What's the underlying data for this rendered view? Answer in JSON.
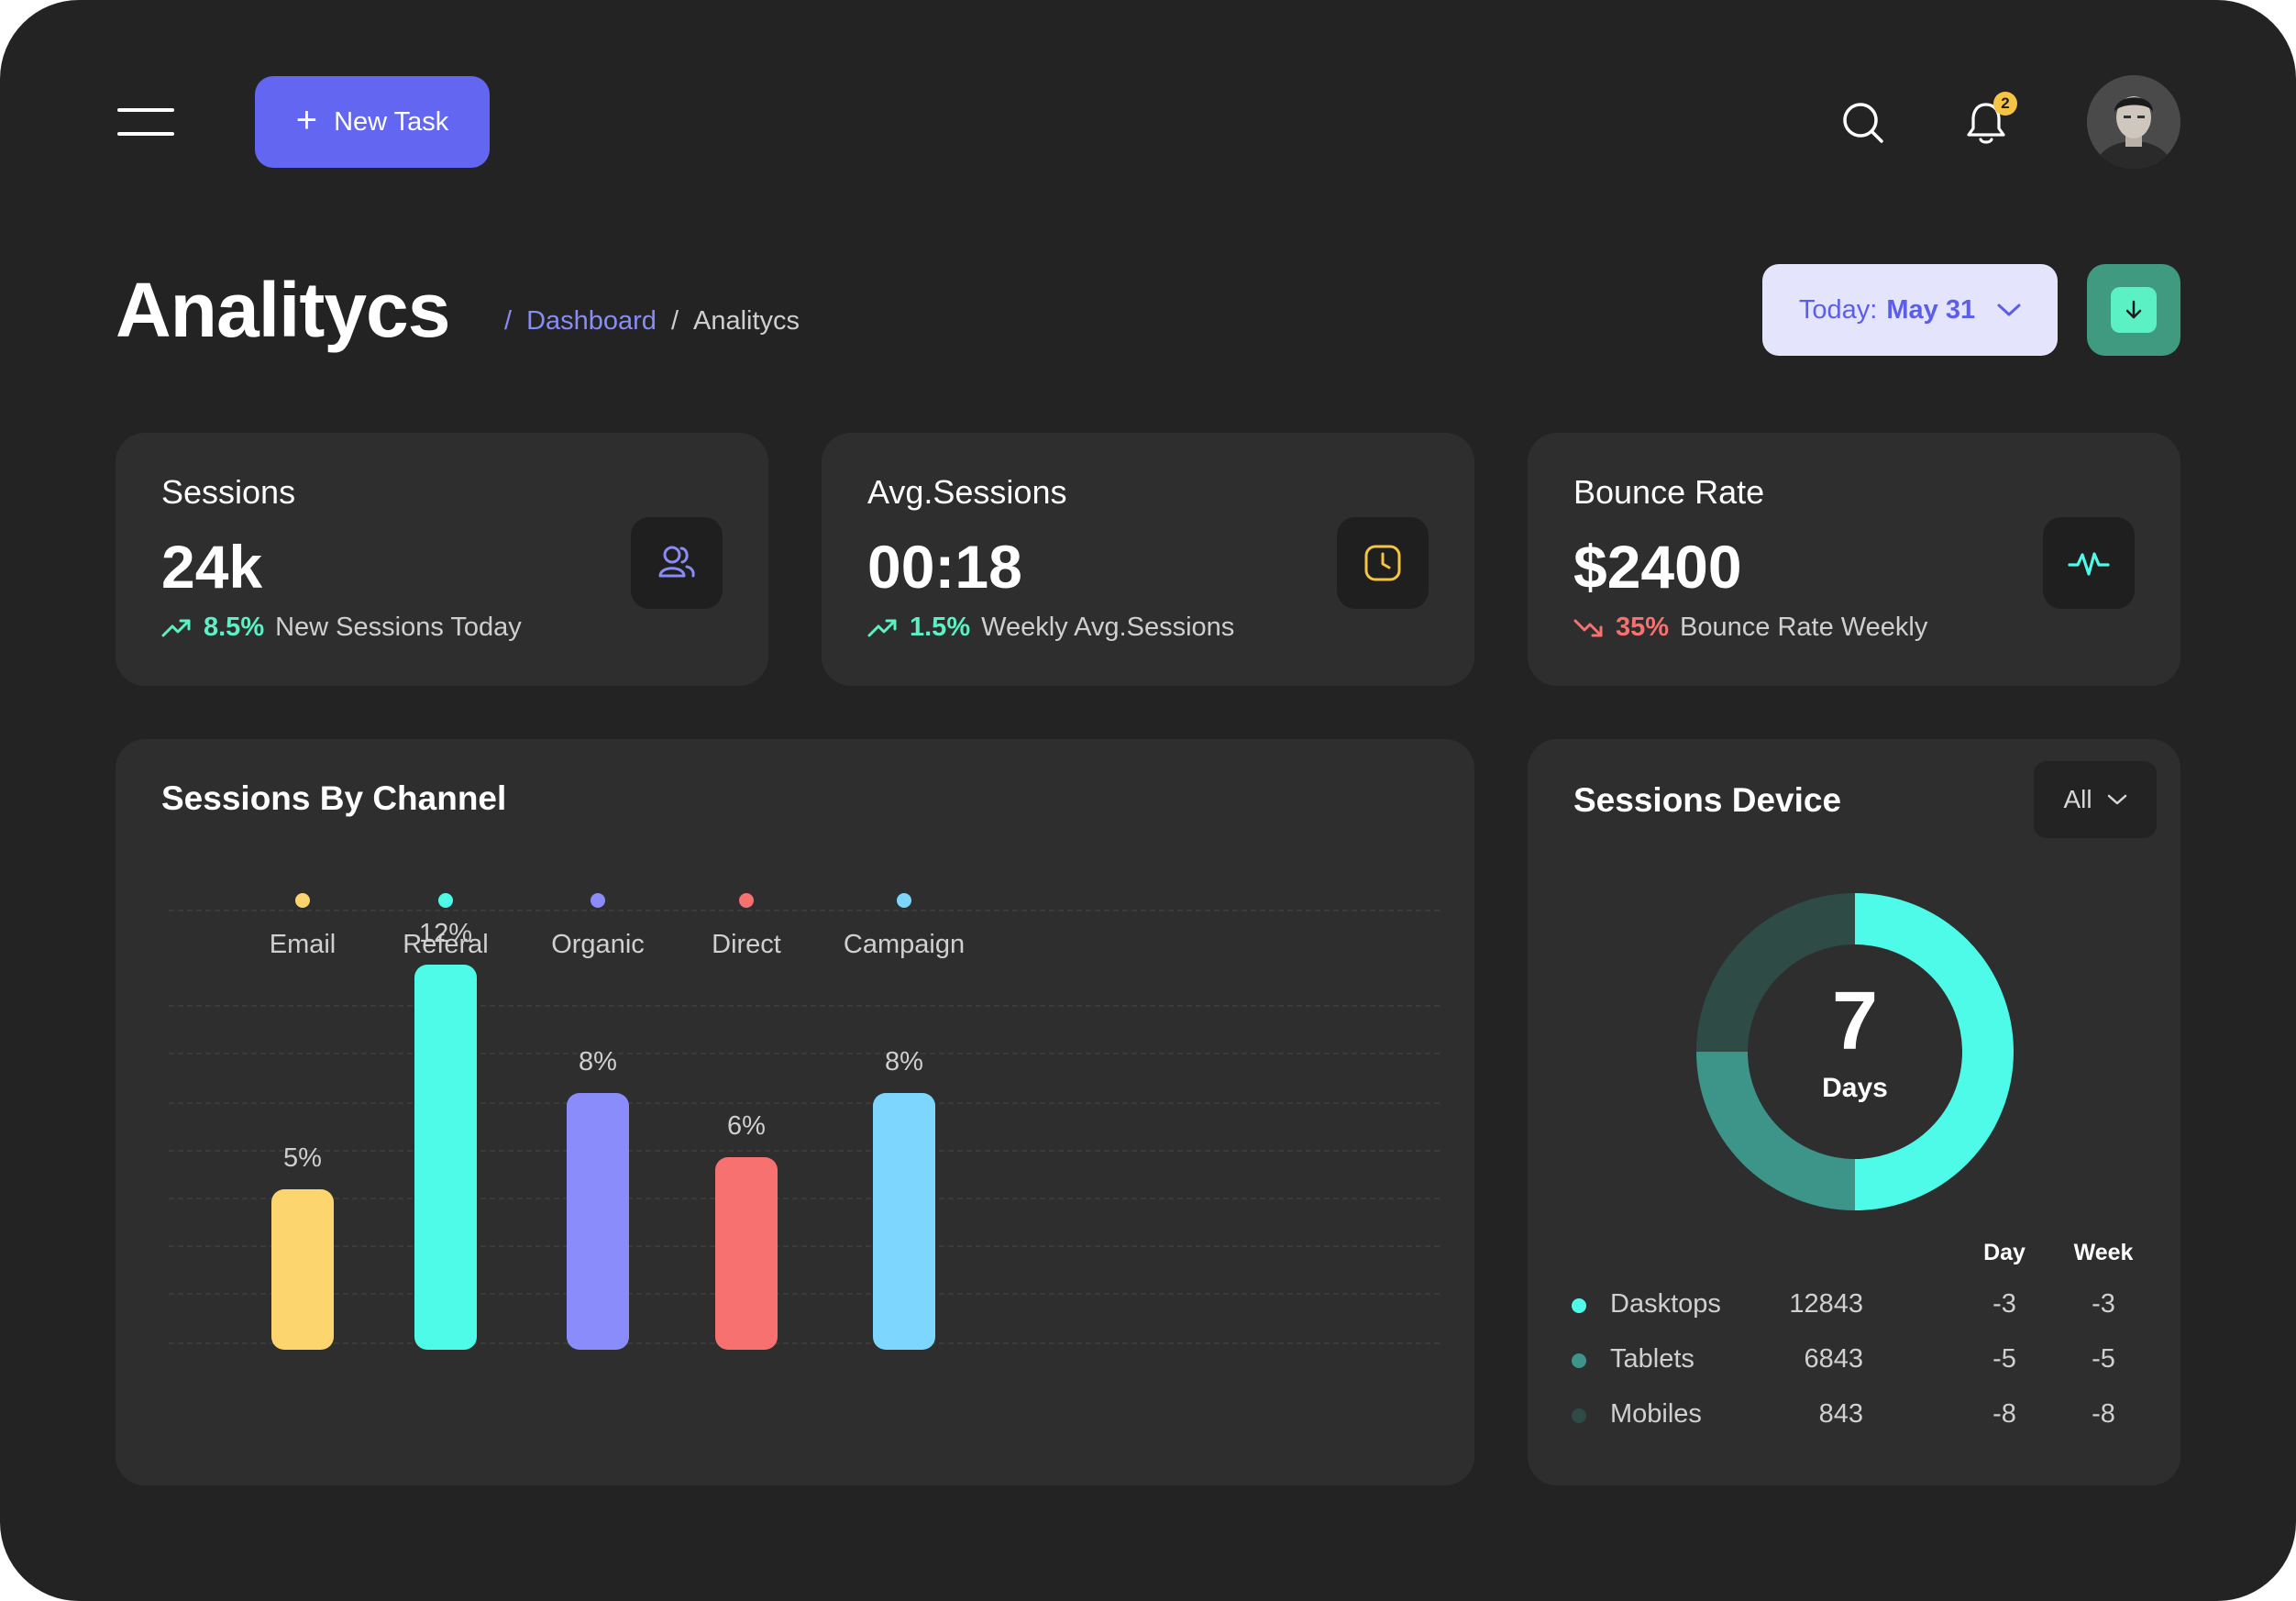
{
  "topbar": {
    "new_task_label": "New Task",
    "notifications_count": "2"
  },
  "header": {
    "title": "Analitycs",
    "breadcrumb": {
      "separator": "/",
      "link": "Dashboard",
      "current": "Analitycs"
    },
    "date_picker": {
      "prefix": "Today:",
      "value": "May 31"
    }
  },
  "stats": [
    {
      "label": "Sessions",
      "value": "24k",
      "trend_pct": "8.5%",
      "trend_desc": "New Sessions Today",
      "trend_direction": "up",
      "icon": "users-icon",
      "accent": "#8a8cf5"
    },
    {
      "label": "Avg.Sessions",
      "value": "00:18",
      "trend_pct": "1.5%",
      "trend_desc": "Weekly Avg.Sessions",
      "trend_direction": "up",
      "icon": "clock-icon",
      "accent": "#f6c445"
    },
    {
      "label": "Bounce Rate",
      "value": "$2400",
      "trend_pct": "35%",
      "trend_desc": "Bounce Rate Weekly",
      "trend_direction": "down",
      "icon": "activity-icon",
      "accent": "#4efbe9"
    }
  ],
  "colors": {
    "up": "#5df0c4",
    "down": "#f87171",
    "primary": "#6366f1"
  },
  "channel": {
    "title": "Sessions By Channel"
  },
  "chart_data": {
    "type": "bar",
    "title": "Sessions By Channel",
    "categories": [
      "Email",
      "Referal",
      "Organic",
      "Direct",
      "Campaign"
    ],
    "values": [
      5,
      12,
      8,
      6,
      8
    ],
    "labels": [
      "5%",
      "12%",
      "8%",
      "6%",
      "8%"
    ],
    "colors": [
      "#fdd56e",
      "#4efbe9",
      "#8b8cfb",
      "#f87171",
      "#7dd6fd"
    ],
    "ylim": [
      0,
      14
    ],
    "grid": true,
    "legend_position": "top"
  },
  "device": {
    "title": "Sessions Device",
    "filter": "All",
    "center_number": "7",
    "center_unit": "Days",
    "donut": [
      {
        "name": "Dasktops",
        "value": 50,
        "color": "#4efbe9"
      },
      {
        "name": "Tablets",
        "value": 25,
        "color": "#3d9488"
      },
      {
        "name": "Mobiles",
        "value": 25,
        "color": "#2e4b46"
      }
    ],
    "columns": {
      "day": "Day",
      "week": "Week"
    },
    "rows": [
      {
        "name": "Dasktops",
        "value": "12843",
        "day": "-3",
        "week": "-3",
        "color": "#4efbe9"
      },
      {
        "name": "Tablets",
        "value": "6843",
        "day": "-5",
        "week": "-5",
        "color": "#3d9488"
      },
      {
        "name": "Mobiles",
        "value": "843",
        "day": "-8",
        "week": "-8",
        "color": "#2e4b46"
      }
    ]
  }
}
